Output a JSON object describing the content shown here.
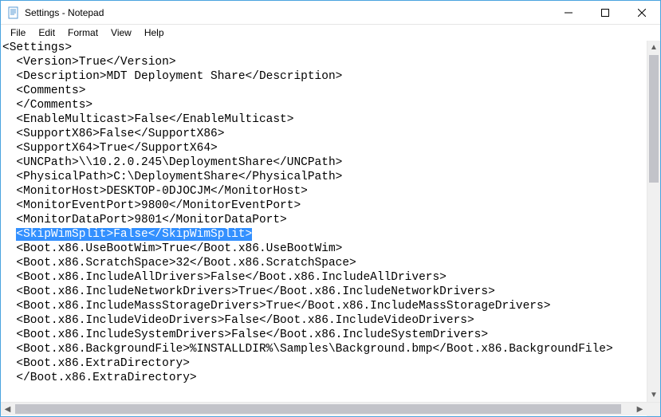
{
  "titlebar": {
    "title": "Settings - Notepad"
  },
  "menu": {
    "file": "File",
    "edit": "Edit",
    "format": "Format",
    "view": "View",
    "help": "Help"
  },
  "lines": [
    {
      "indent": 0,
      "text": "<Settings>"
    },
    {
      "indent": 1,
      "text": "<Version>True</Version>"
    },
    {
      "indent": 1,
      "text": "<Description>MDT Deployment Share</Description>"
    },
    {
      "indent": 1,
      "text": "<Comments>"
    },
    {
      "indent": 1,
      "text": "</Comments>"
    },
    {
      "indent": 1,
      "text": "<EnableMulticast>False</EnableMulticast>"
    },
    {
      "indent": 1,
      "text": "<SupportX86>False</SupportX86>"
    },
    {
      "indent": 1,
      "text": "<SupportX64>True</SupportX64>"
    },
    {
      "indent": 1,
      "text": "<UNCPath>\\\\10.2.0.245\\DeploymentShare</UNCPath>"
    },
    {
      "indent": 1,
      "text": "<PhysicalPath>C:\\DeploymentShare</PhysicalPath>"
    },
    {
      "indent": 1,
      "text": "<MonitorHost>DESKTOP-0DJOCJM</MonitorHost>"
    },
    {
      "indent": 1,
      "text": "<MonitorEventPort>9800</MonitorEventPort>"
    },
    {
      "indent": 1,
      "text": "<MonitorDataPort>9801</MonitorDataPort>"
    },
    {
      "indent": 1,
      "text": "<SkipWimSplit>False</SkipWimSplit>",
      "highlight": true
    },
    {
      "indent": 1,
      "text": "<Boot.x86.UseBootWim>True</Boot.x86.UseBootWim>"
    },
    {
      "indent": 1,
      "text": "<Boot.x86.ScratchSpace>32</Boot.x86.ScratchSpace>"
    },
    {
      "indent": 1,
      "text": "<Boot.x86.IncludeAllDrivers>False</Boot.x86.IncludeAllDrivers>"
    },
    {
      "indent": 1,
      "text": "<Boot.x86.IncludeNetworkDrivers>True</Boot.x86.IncludeNetworkDrivers>"
    },
    {
      "indent": 1,
      "text": "<Boot.x86.IncludeMassStorageDrivers>True</Boot.x86.IncludeMassStorageDrivers>"
    },
    {
      "indent": 1,
      "text": "<Boot.x86.IncludeVideoDrivers>False</Boot.x86.IncludeVideoDrivers>"
    },
    {
      "indent": 1,
      "text": "<Boot.x86.IncludeSystemDrivers>False</Boot.x86.IncludeSystemDrivers>"
    },
    {
      "indent": 1,
      "text": "<Boot.x86.BackgroundFile>%INSTALLDIR%\\Samples\\Background.bmp</Boot.x86.BackgroundFile>"
    },
    {
      "indent": 1,
      "text": "<Boot.x86.ExtraDirectory>"
    },
    {
      "indent": 1,
      "text": "</Boot.x86.ExtraDirectory>"
    }
  ]
}
